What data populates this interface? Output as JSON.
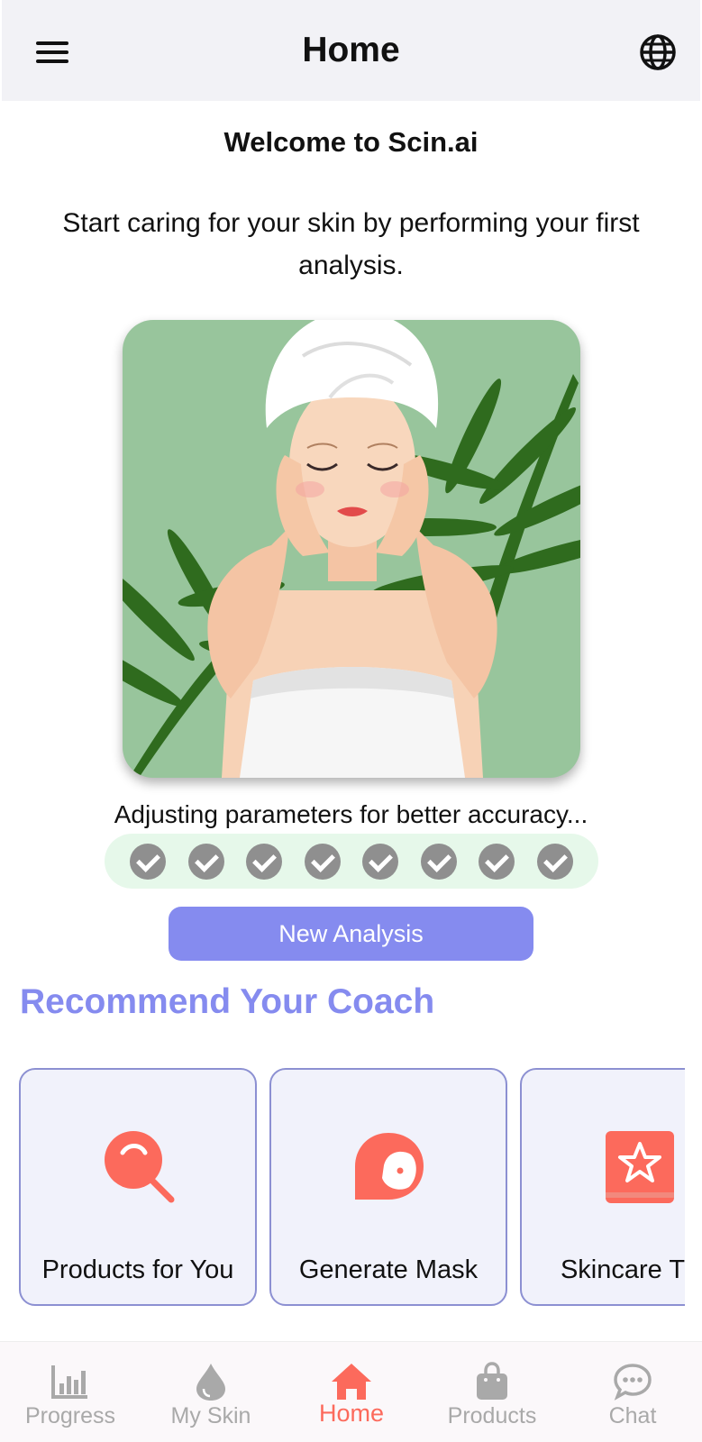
{
  "header": {
    "title": "Home",
    "menu_icon": "hamburger-menu-icon",
    "language_icon": "globe-icon"
  },
  "welcome": {
    "title": "Welcome to Scin.ai",
    "subtitle": "Start caring for your skin by performing your first analysis."
  },
  "hero_image": {
    "description_icon": "woman-skincare-illustration"
  },
  "analysis": {
    "status_text": "Adjusting parameters for better accuracy...",
    "completed_steps": 8,
    "total_steps": 8,
    "button_label": "New Analysis"
  },
  "coach": {
    "section_title": "Recommend Your Coach",
    "cards": [
      {
        "label": "Products for You",
        "icon": "magnifier-icon"
      },
      {
        "label": "Generate Mask",
        "icon": "face-mask-icon"
      },
      {
        "label": "Skincare Tips",
        "icon": "star-book-icon"
      }
    ]
  },
  "bottom_nav": {
    "items": [
      {
        "label": "Progress",
        "icon": "bar-chart-icon"
      },
      {
        "label": "My Skin",
        "icon": "droplet-icon"
      },
      {
        "label": "Home",
        "icon": "home-icon"
      },
      {
        "label": "Products",
        "icon": "shopping-bag-icon"
      },
      {
        "label": "Chat",
        "icon": "chat-bubble-icon"
      }
    ],
    "active": "Home"
  },
  "colors": {
    "accent": "#858bef",
    "active_nav": "#fc6a5c",
    "icon_coral": "#fc6a5c",
    "hero_bg": "#98c59c",
    "step_bg": "#e6f8ea",
    "step_check": "#8f8f8f"
  }
}
